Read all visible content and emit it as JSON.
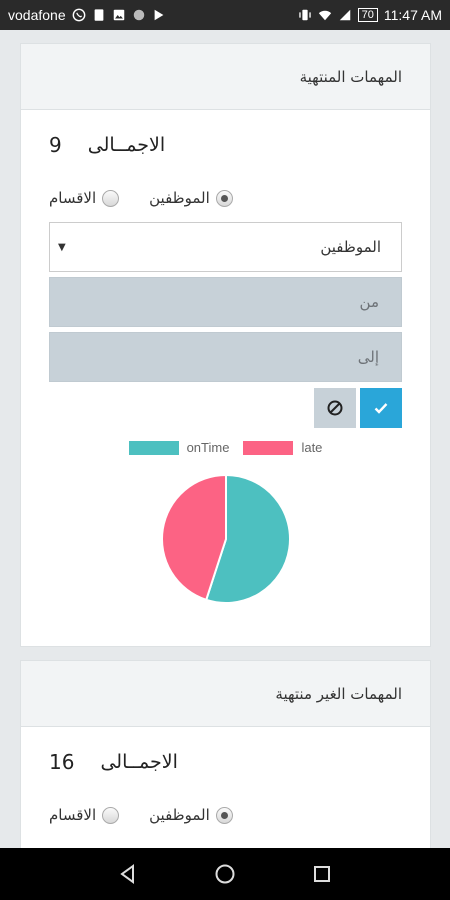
{
  "status_bar": {
    "carrier": "vodafone",
    "battery": "70",
    "time": "11:47 AM",
    "left_icons": [
      "whatsapp-icon",
      "sim-icon",
      "gallery-icon",
      "circle-icon",
      "send-icon"
    ],
    "right_icons": [
      "vibrate-icon",
      "wifi-icon",
      "signal-icon",
      "battery-icon"
    ]
  },
  "completed_tasks": {
    "title": "المهمات المنتهية",
    "total_label": "الاجمــالى",
    "total_value": "9",
    "radio_employees": "الموظفين",
    "radio_departments": "الاقسام",
    "selected_radio": "employees",
    "select_value": "الموظفين",
    "from_placeholder": "من",
    "to_placeholder": "إلى",
    "legend": [
      {
        "label": "onTime",
        "color": "#4dc0c0"
      },
      {
        "label": "late",
        "color": "#fc6384"
      }
    ]
  },
  "chart_data": {
    "type": "pie",
    "categories": [
      "onTime",
      "late"
    ],
    "values": [
      55,
      45
    ],
    "colors": [
      "#4dc0c0",
      "#fc6384"
    ]
  },
  "incomplete_tasks": {
    "title": "المهمات الغير منتهية",
    "total_label": "الاجمــالى",
    "total_value": "16",
    "radio_employees": "الموظفين",
    "radio_departments": "الاقسام",
    "selected_radio": "employees"
  }
}
